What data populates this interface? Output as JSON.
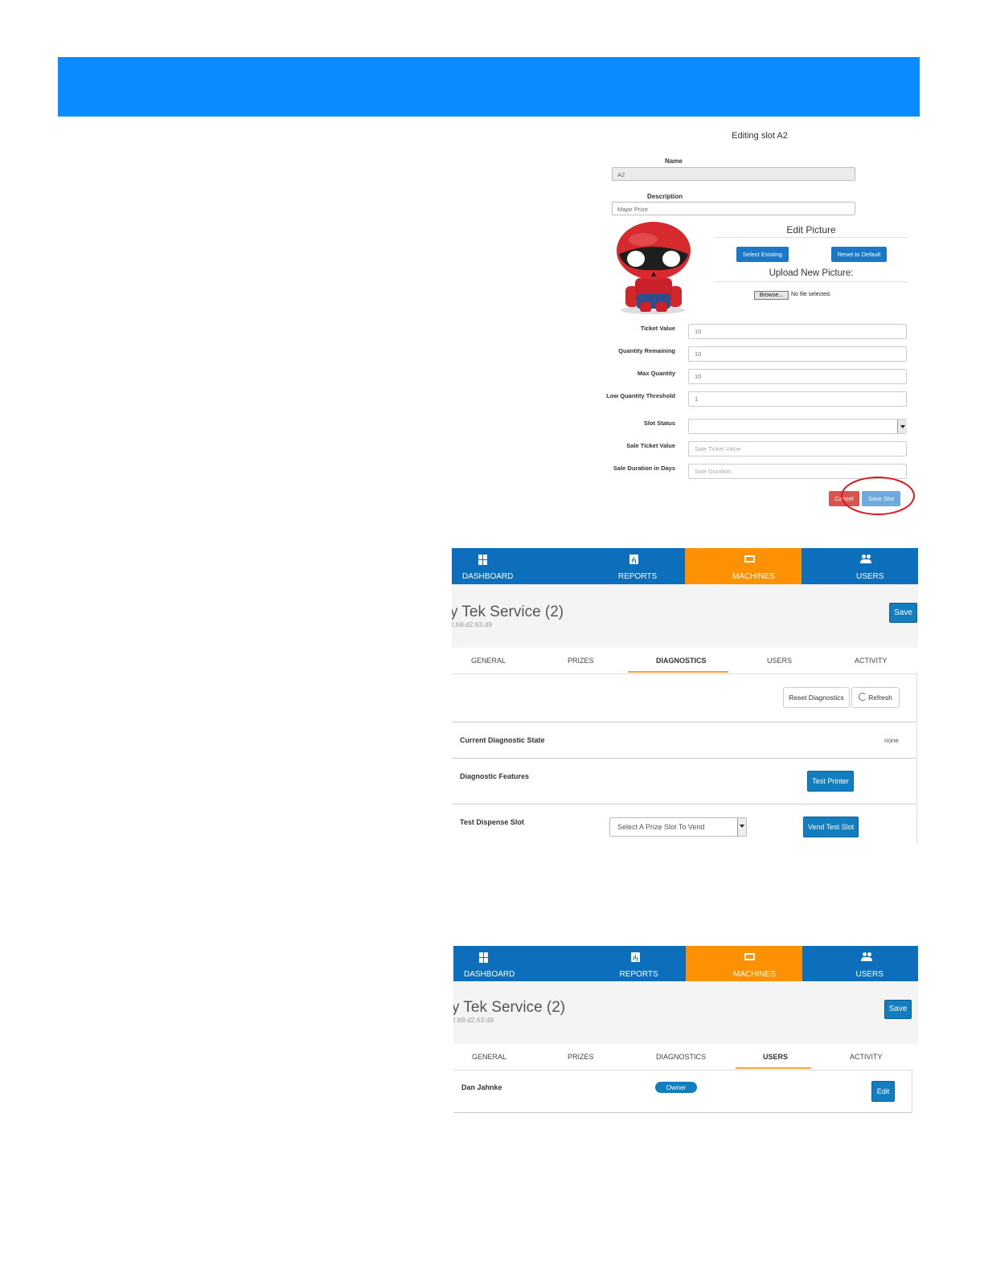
{
  "colors": {
    "banner": "#0a8bff",
    "nav_blue": "#0d6fbc",
    "nav_active": "#fb9103",
    "save_blue": "#127dbf",
    "cancel_red": "#d9534f",
    "highlight_circle": "#e1141b"
  },
  "slot_form": {
    "title": "Editing slot A2",
    "name_label": "Name",
    "name_value": "A2",
    "description_label": "Description",
    "description_value": "Major Prize",
    "edit_picture_title": "Edit Picture",
    "select_existing_label": "Select Existing",
    "reset_default_label": "Reset to Default",
    "upload_title": "Upload New Picture:",
    "browse_label": "Browse...",
    "no_file_text": "No file selected.",
    "fields": [
      {
        "label": "Ticket Value",
        "value": "10",
        "placeholder": ""
      },
      {
        "label": "Quantity Remaining",
        "value": "10",
        "placeholder": ""
      },
      {
        "label": "Max Quantity",
        "value": "10",
        "placeholder": ""
      },
      {
        "label": "Low Quantity Threshold",
        "value": "1",
        "placeholder": ""
      },
      {
        "label": "Slot Status",
        "value": "",
        "placeholder": ""
      },
      {
        "label": "Sale Ticket Value",
        "value": "",
        "placeholder": "Sale Ticket Value"
      },
      {
        "label": "Sale Duration in Days",
        "value": "",
        "placeholder": "Sale Duration"
      }
    ],
    "cancel_label": "Cancel",
    "save_slot_label": "Save Slot"
  },
  "nav": {
    "dashboard": "DASHBOARD",
    "reports": "REPORTS",
    "machines": "MACHINES",
    "users": "USERS",
    "active": "MACHINES"
  },
  "machine": {
    "title": "y Tek Service (2)",
    "subtitle": "2.b9.d2.63.d9",
    "save_label": "Save"
  },
  "subtabs": [
    "GENERAL",
    "PRIZES",
    "DIAGNOSTICS",
    "USERS",
    "ACTIVITY"
  ],
  "diagnostics": {
    "active_tab": "DIAGNOSTICS",
    "reset_label": "Reset Diagnostics",
    "refresh_label": "Refresh",
    "current_state_label": "Current Diagnostic State",
    "current_state_value": "none",
    "features_label": "Diagnostic Features",
    "test_printer_label": "Test Printer",
    "test_dispense_label": "Test Dispense Slot",
    "select_placeholder": "Select A Prize Slot To Vend",
    "vend_test_label": "Vend Test Slot"
  },
  "users_panel": {
    "active_tab": "USERS",
    "user_name": "Dan Jahnke",
    "role_badge": "Owner",
    "edit_label": "Edit"
  }
}
